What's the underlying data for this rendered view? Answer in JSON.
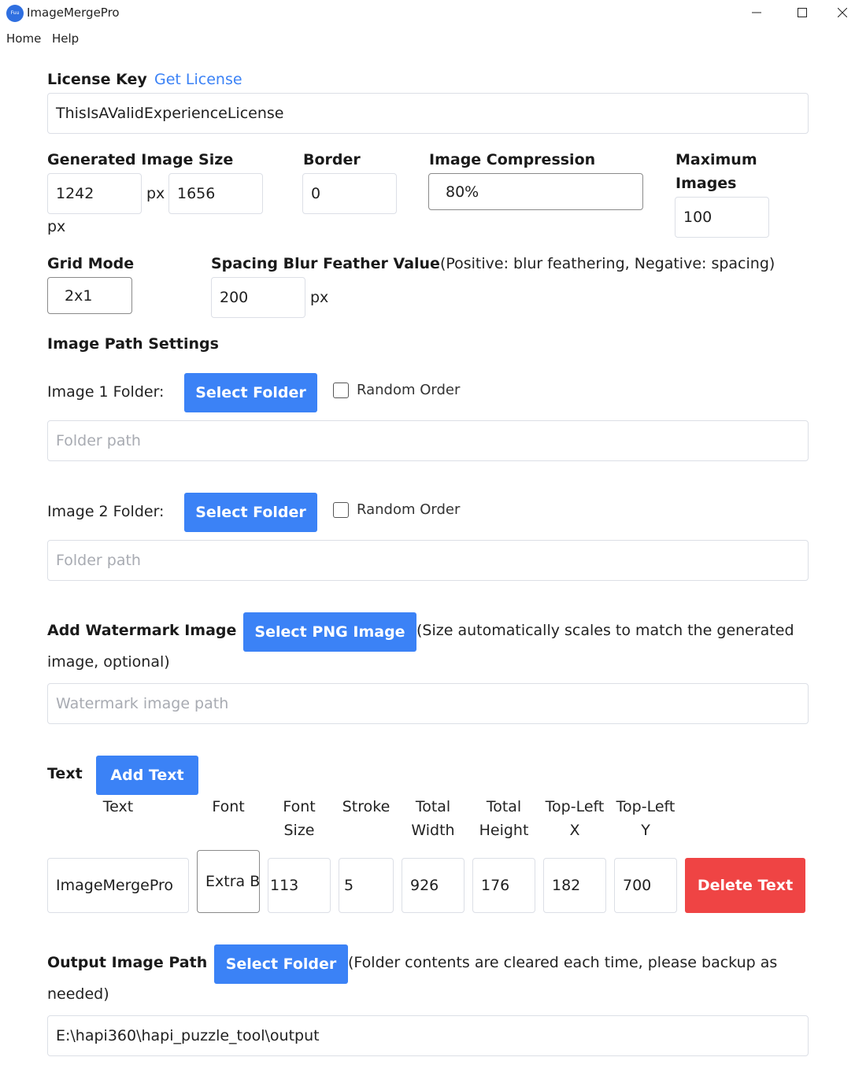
{
  "window": {
    "title": "ImageMergePro",
    "icon_text": "Fuu",
    "menu": [
      "Home",
      "Help"
    ]
  },
  "license": {
    "label": "License Key",
    "link": "Get License",
    "value": "ThisIsAValidExperienceLicense"
  },
  "image_size": {
    "label": "Generated Image Size",
    "width": "1242",
    "height": "1656",
    "unit": "px"
  },
  "border": {
    "label": "Border",
    "value": "0"
  },
  "compression": {
    "label": "Image Compression",
    "value": "80%"
  },
  "max_images": {
    "label_line1": "Maximum",
    "label_line2": "Images",
    "value": "100"
  },
  "grid_mode": {
    "label": "Grid Mode",
    "value": "2x1"
  },
  "spacing": {
    "label": "Spacing Blur Feather Value",
    "hint": "(Positive: blur feathering, Negative: spacing)",
    "value": "200",
    "unit": "px"
  },
  "image_paths": {
    "heading": "Image Path Settings",
    "folders": [
      {
        "label": "Image 1 Folder:",
        "button": "Select Folder",
        "random_label": "Random Order",
        "placeholder": "Folder path"
      },
      {
        "label": "Image 2 Folder:",
        "button": "Select Folder",
        "random_label": "Random Order",
        "placeholder": "Folder path"
      }
    ]
  },
  "watermark": {
    "label": "Add Watermark Image",
    "button": "Select PNG Image",
    "hint_line1": "(Size automatically scales to match the generated",
    "hint_line2": "image, optional)",
    "placeholder": "Watermark image path"
  },
  "text_section": {
    "label": "Text",
    "add_button": "Add Text",
    "columns": [
      [
        "Text"
      ],
      [
        "Font"
      ],
      [
        "Font",
        "Size"
      ],
      [
        "Stroke"
      ],
      [
        "Total",
        "Width"
      ],
      [
        "Total",
        "Height"
      ],
      [
        "Top-Left",
        "X"
      ],
      [
        "Top-Left",
        "Y"
      ]
    ],
    "row": {
      "text": "ImageMergePro",
      "font": "Extra Bold",
      "font_size": "113",
      "stroke": "5",
      "total_width": "926",
      "total_height": "176",
      "top_left_x": "182",
      "top_left_y": "700",
      "delete_button": "Delete Text"
    }
  },
  "output": {
    "label": "Output Image Path",
    "button": "Select Folder",
    "hint_line1": "(Folder contents are cleared each time, please backup as",
    "hint_line2": "needed)",
    "value": "E:\\hapi360\\hapi_puzzle_tool\\output"
  },
  "colors": {
    "primary": "#3b82f6",
    "danger": "#ef4444",
    "link": "#3b82f6"
  }
}
